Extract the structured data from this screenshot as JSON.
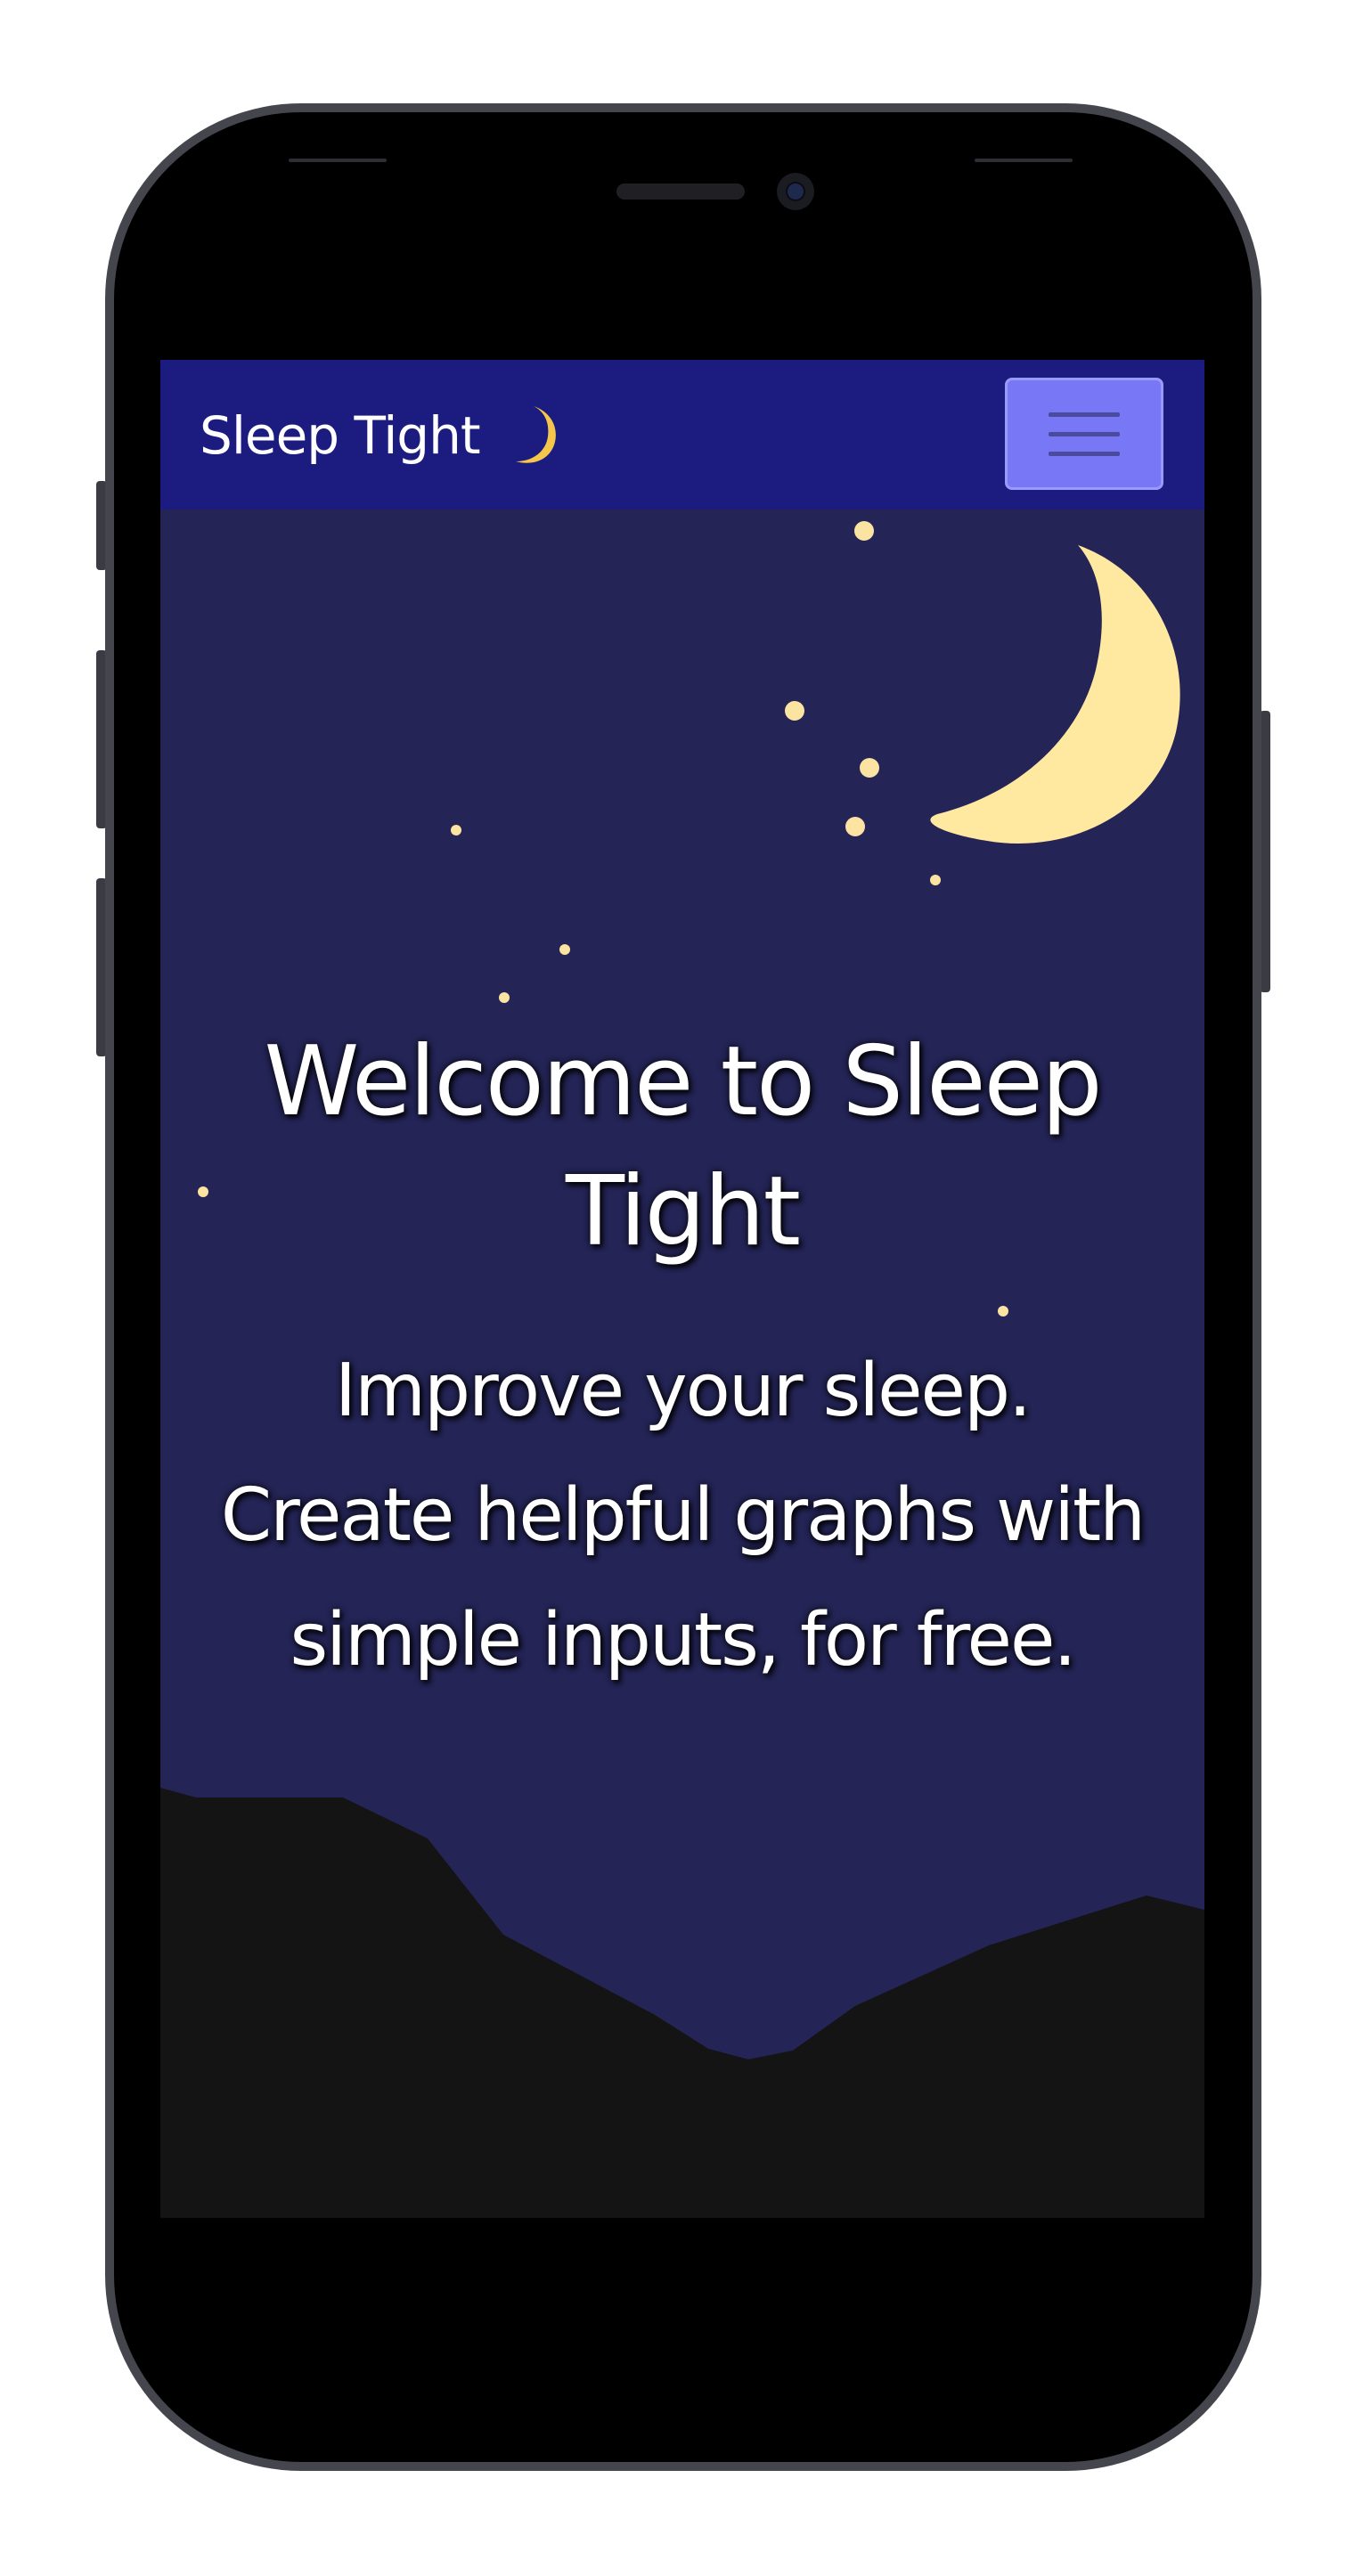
{
  "navbar": {
    "brand_text": "Sleep Tight",
    "brand_icon": "crescent-moon-icon",
    "menu_icon": "hamburger-menu-icon"
  },
  "hero": {
    "title": "Welcome to Sleep Tight",
    "subtitle": "Improve your sleep. Create helpful graphs with simple inputs, for free."
  },
  "colors": {
    "navbar_bg": "#1c1c80",
    "sky_bg": "#242456",
    "moon": "#ffe8a0",
    "brand_moon": "#f5c64a",
    "mountains": "#141414",
    "menu_button": "#7878f6",
    "text": "#ffffff",
    "phone_frame": "#45454e"
  }
}
